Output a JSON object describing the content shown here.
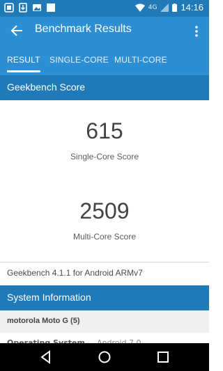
{
  "status_bar": {
    "time": "14:16",
    "network": "4G",
    "icons": [
      "notification-icon",
      "download-icon",
      "image-icon",
      "square-icon",
      "wifi-icon",
      "signal-icon",
      "battery-icon"
    ]
  },
  "appbar": {
    "title": "Benchmark Results",
    "back_icon": "arrow-left-icon",
    "menu_icon": "more-vert-icon"
  },
  "tabs": [
    {
      "label": "RESULT",
      "active": true
    },
    {
      "label": "SINGLE-CORE",
      "active": false
    },
    {
      "label": "MULTI-CORE",
      "active": false
    }
  ],
  "geekbench_section": {
    "title": "Geekbench Score",
    "single_core": {
      "value": "615",
      "label": "Single-Core Score"
    },
    "multi_core": {
      "value": "2509",
      "label": "Multi-Core Score"
    },
    "version_text": "Geekbench 4.1.1 for Android ARMv7"
  },
  "system_info": {
    "title": "System Information",
    "device": "motorola Moto G (5)",
    "rows": [
      {
        "label": "Operating System",
        "value": "Android 7.0"
      }
    ]
  },
  "colors": {
    "statusbar": "#1f7ab7",
    "appbar": "#2d8fd3",
    "section_header": "#1f7ab7",
    "device_row": "#efefef",
    "navbar": "#000000"
  }
}
